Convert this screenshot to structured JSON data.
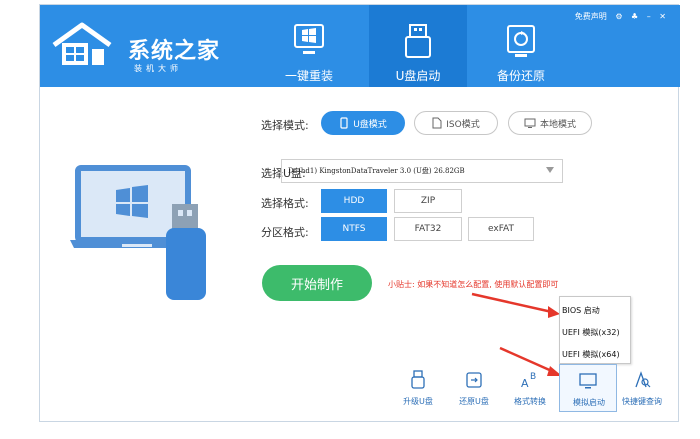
{
  "header": {
    "brand": "系统之家",
    "brand_sub": "装机大师",
    "top_right": [
      "免费声明",
      "⚙",
      "♣",
      "–",
      "✕"
    ],
    "tabs": [
      {
        "label": "一键重装",
        "icon": "windows-screen-icon"
      },
      {
        "label": "U盘启动",
        "icon": "usb-drive-icon"
      },
      {
        "label": "备份还原",
        "icon": "backup-restore-icon"
      }
    ],
    "active_tab": "U盘启动"
  },
  "form": {
    "mode_label": "选择模式:",
    "modes": [
      {
        "label": "U盘模式",
        "selected": true
      },
      {
        "label": "ISO模式",
        "selected": false
      },
      {
        "label": "本地模式",
        "selected": false
      }
    ],
    "disk_label": "选择U盘:",
    "disk_value": "D: (hd1) KingstonDataTraveler 3.0 (U盘) 26.82GB",
    "format_label": "选择格式:",
    "formats": [
      {
        "label": "HDD",
        "selected": true
      },
      {
        "label": "ZIP",
        "selected": false
      }
    ],
    "partition_label": "分区格式:",
    "partitions": [
      {
        "label": "NTFS",
        "selected": true
      },
      {
        "label": "FAT32",
        "selected": false
      },
      {
        "label": "exFAT",
        "selected": false
      }
    ],
    "start_button": "开始制作",
    "tip": "小贴士: 如果不知道怎么配置, 使用默认配置即可"
  },
  "boot_menu": {
    "items": [
      "BIOS 启动",
      "UEFI 模拟(x32)",
      "UEFI 模拟(x64)"
    ]
  },
  "toolbar": [
    {
      "label": "升级U盘",
      "icon": "usb-upgrade-icon"
    },
    {
      "label": "还原U盘",
      "icon": "restore-usb-icon"
    },
    {
      "label": "格式转换",
      "icon": "format-convert-icon"
    },
    {
      "label": "模拟启动",
      "icon": "monitor-icon",
      "active": true
    },
    {
      "label": "快捷键查询",
      "icon": "shortcut-search-icon"
    }
  ],
  "colors": {
    "primary": "#2d8ee5",
    "green": "#3dbb6b",
    "red": "#e5372b"
  }
}
